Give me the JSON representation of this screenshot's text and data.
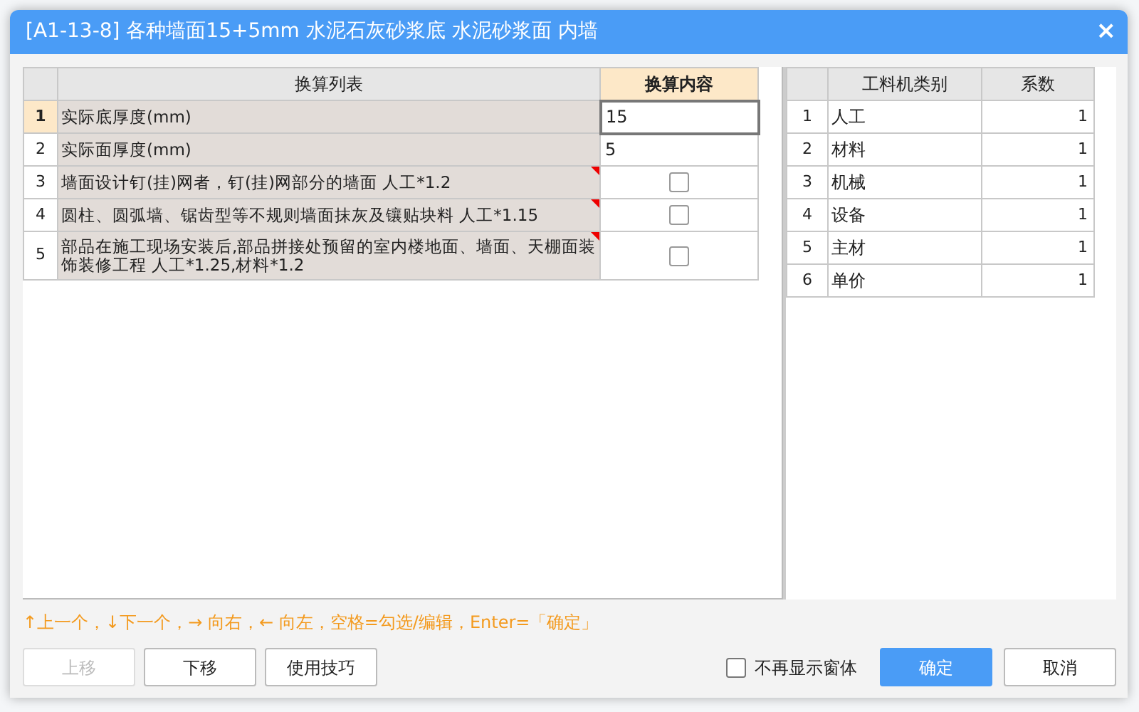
{
  "window": {
    "title": "[A1-13-8] 各种墙面15+5mm 水泥石灰砂浆底 水泥砂浆面 内墙",
    "close": "×"
  },
  "conversion_table": {
    "columns": [
      "换算列表",
      "换算内容"
    ],
    "rows": [
      {
        "index": "1",
        "name": "实际底厚度(mm)",
        "kind": "input",
        "value": "15",
        "selected": true,
        "note": false
      },
      {
        "index": "2",
        "name": "实际面厚度(mm)",
        "kind": "input",
        "value": "5",
        "selected": false,
        "note": false
      },
      {
        "index": "3",
        "name": "墙面设计钉(挂)网者，钉(挂)网部分的墙面 人工*1.2",
        "kind": "checkbox",
        "checked": false,
        "selected": false,
        "note": true
      },
      {
        "index": "4",
        "name": "圆柱、圆弧墙、锯齿型等不规则墙面抹灰及镶贴块料 人工*1.15",
        "kind": "checkbox",
        "checked": false,
        "selected": false,
        "note": true
      },
      {
        "index": "5",
        "name": "部品在施工现场安装后,部品拼接处预留的室内楼地面、墙面、天棚面装饰装修工程 人工*1.25,材料*1.2",
        "kind": "checkbox",
        "checked": false,
        "selected": false,
        "note": true
      }
    ]
  },
  "factor_table": {
    "columns": [
      "工料机类别",
      "系数"
    ],
    "rows": [
      {
        "index": "1",
        "category": "人工",
        "factor": "1"
      },
      {
        "index": "2",
        "category": "材料",
        "factor": "1"
      },
      {
        "index": "3",
        "category": "机械",
        "factor": "1"
      },
      {
        "index": "4",
        "category": "设备",
        "factor": "1"
      },
      {
        "index": "5",
        "category": "主材",
        "factor": "1"
      },
      {
        "index": "6",
        "category": "单价",
        "factor": "1"
      }
    ]
  },
  "hint": "↑上一个，↓下一个，→ 向右，← 向左，空格=勾选/编辑，Enter=「确定」",
  "left_buttons": [
    {
      "label": "上移",
      "disabled": true
    },
    {
      "label": "下移",
      "disabled": false
    },
    {
      "label": "使用技巧",
      "disabled": false
    }
  ],
  "dont_show_again": {
    "label": "不再显示窗体",
    "checked": false
  },
  "right_buttons": [
    {
      "label": "确定",
      "primary": true
    },
    {
      "label": "取消",
      "primary": false
    }
  ]
}
